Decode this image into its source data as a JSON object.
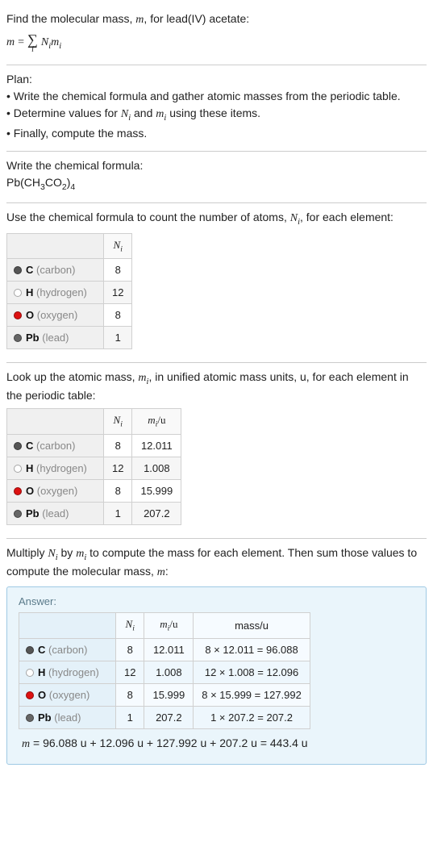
{
  "intro": {
    "line1_pre": "Find the molecular mass, ",
    "line1_var": "m",
    "line1_post": ", for lead(IV) acetate:",
    "eq_m": "m",
    "eq_eq": "=",
    "eq_sigma": "∑",
    "eq_sigma_sub": "i",
    "eq_rhs": "N",
    "eq_rhs_sub1": "i",
    "eq_rhs2": "m",
    "eq_rhs_sub2": "i"
  },
  "plan": {
    "title": "Plan:",
    "b1_pre": "• Write the chemical formula and gather atomic masses from the periodic table.",
    "b2_pre": "• Determine values for ",
    "b2_v1": "N",
    "b2_s1": "i",
    "b2_mid": " and ",
    "b2_v2": "m",
    "b2_s2": "i",
    "b2_post": " using these items.",
    "b3": "• Finally, compute the mass."
  },
  "sec_formula": {
    "title": "Write the chemical formula:",
    "f_pb": "Pb(CH",
    "f_3": "3",
    "f_co": "CO",
    "f_2": "2",
    "f_close": ")",
    "f_4": "4"
  },
  "sec_count": {
    "pre": "Use the chemical formula to count the number of atoms, ",
    "v": "N",
    "s": "i",
    "post": ", for each element:",
    "th_ni": "N",
    "th_ni_sub": "i"
  },
  "elements": {
    "c": {
      "sym": "C",
      "name": "(carbon)",
      "n": "8",
      "m": "12.011",
      "mass": "8 × 12.011 = 96.088",
      "color": "#555"
    },
    "h": {
      "sym": "H",
      "name": "(hydrogen)",
      "n": "12",
      "m": "1.008",
      "mass": "12 × 1.008 = 12.096",
      "color": "#fff"
    },
    "o": {
      "sym": "O",
      "name": "(oxygen)",
      "n": "8",
      "m": "15.999",
      "mass": "8 × 15.999 = 127.992",
      "color": "#d11"
    },
    "pb": {
      "sym": "Pb",
      "name": "(lead)",
      "n": "1",
      "m": "207.2",
      "mass": "1 × 207.2 = 207.2",
      "color": "#666"
    }
  },
  "sec_mass": {
    "pre": "Look up the atomic mass, ",
    "v": "m",
    "s": "i",
    "post": ", in unified atomic mass units, u, for each element in the periodic table:",
    "th_ni": "N",
    "th_ni_sub": "i",
    "th_mi": "m",
    "th_mi_sub": "i",
    "th_mi_u": "/u"
  },
  "sec_mult": {
    "pre": "Multiply ",
    "v1": "N",
    "s1": "i",
    "mid": " by ",
    "v2": "m",
    "s2": "i",
    "post1": " to compute the mass for each element. Then sum those values to compute the molecular mass, ",
    "v3": "m",
    "post2": ":"
  },
  "answer": {
    "label": "Answer:",
    "th_ni": "N",
    "th_ni_sub": "i",
    "th_mi": "m",
    "th_mi_sub": "i",
    "th_mi_u": "/u",
    "th_mass": "mass/u",
    "final_m": "m",
    "final": " = 96.088 u + 12.096 u + 127.992 u + 207.2 u = 443.4 u"
  }
}
